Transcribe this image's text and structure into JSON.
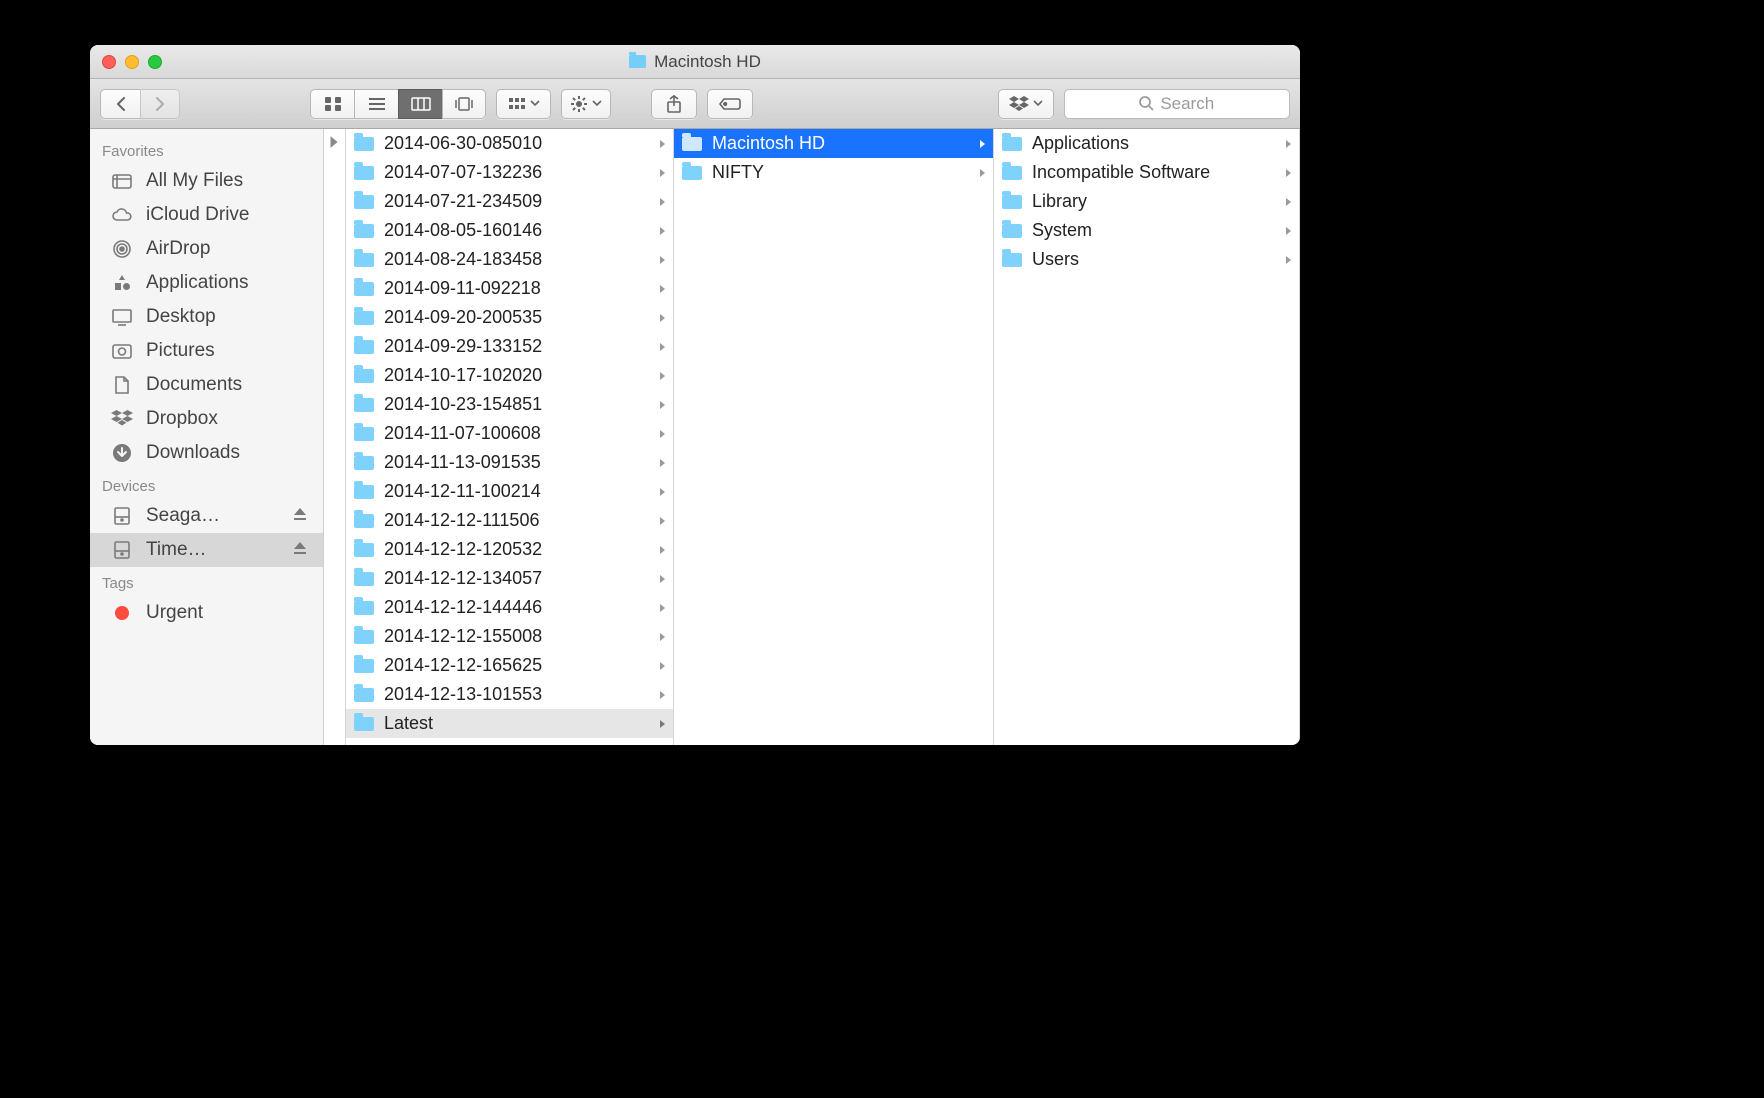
{
  "window": {
    "title": "Macintosh HD"
  },
  "search": {
    "placeholder": "Search"
  },
  "sidebar": {
    "sections": [
      {
        "header": "Favorites",
        "items": [
          {
            "label": "All My Files",
            "icon": "allmyfiles"
          },
          {
            "label": "iCloud Drive",
            "icon": "cloud"
          },
          {
            "label": "AirDrop",
            "icon": "airdrop"
          },
          {
            "label": "Applications",
            "icon": "apps"
          },
          {
            "label": "Desktop",
            "icon": "desktop"
          },
          {
            "label": "Pictures",
            "icon": "pictures"
          },
          {
            "label": "Documents",
            "icon": "documents"
          },
          {
            "label": "Dropbox",
            "icon": "dropbox"
          },
          {
            "label": "Downloads",
            "icon": "downloads"
          }
        ]
      },
      {
        "header": "Devices",
        "items": [
          {
            "label": "Seaga…",
            "icon": "disk",
            "eject": true
          },
          {
            "label": "Time…",
            "icon": "disk",
            "eject": true,
            "active": true
          }
        ]
      },
      {
        "header": "Tags",
        "items": [
          {
            "label": "Urgent",
            "icon": "tag-red"
          }
        ]
      }
    ]
  },
  "columns": {
    "col1": [
      {
        "label": "2014-06-30-085010"
      },
      {
        "label": "2014-07-07-132236"
      },
      {
        "label": "2014-07-21-234509"
      },
      {
        "label": "2014-08-05-160146"
      },
      {
        "label": "2014-08-24-183458"
      },
      {
        "label": "2014-09-11-092218"
      },
      {
        "label": "2014-09-20-200535"
      },
      {
        "label": "2014-09-29-133152"
      },
      {
        "label": "2014-10-17-102020"
      },
      {
        "label": "2014-10-23-154851"
      },
      {
        "label": "2014-11-07-100608"
      },
      {
        "label": "2014-11-13-091535"
      },
      {
        "label": "2014-12-11-100214"
      },
      {
        "label": "2014-12-12-111506"
      },
      {
        "label": "2014-12-12-120532"
      },
      {
        "label": "2014-12-12-134057"
      },
      {
        "label": "2014-12-12-144446"
      },
      {
        "label": "2014-12-12-155008"
      },
      {
        "label": "2014-12-12-165625"
      },
      {
        "label": "2014-12-13-101553"
      },
      {
        "label": "Latest",
        "selected": true
      }
    ],
    "col2": [
      {
        "label": "Macintosh HD",
        "highlight": true
      },
      {
        "label": "NIFTY"
      }
    ],
    "col3": [
      {
        "label": "Applications"
      },
      {
        "label": "Incompatible Software"
      },
      {
        "label": "Library"
      },
      {
        "label": "System"
      },
      {
        "label": "Users"
      }
    ]
  }
}
